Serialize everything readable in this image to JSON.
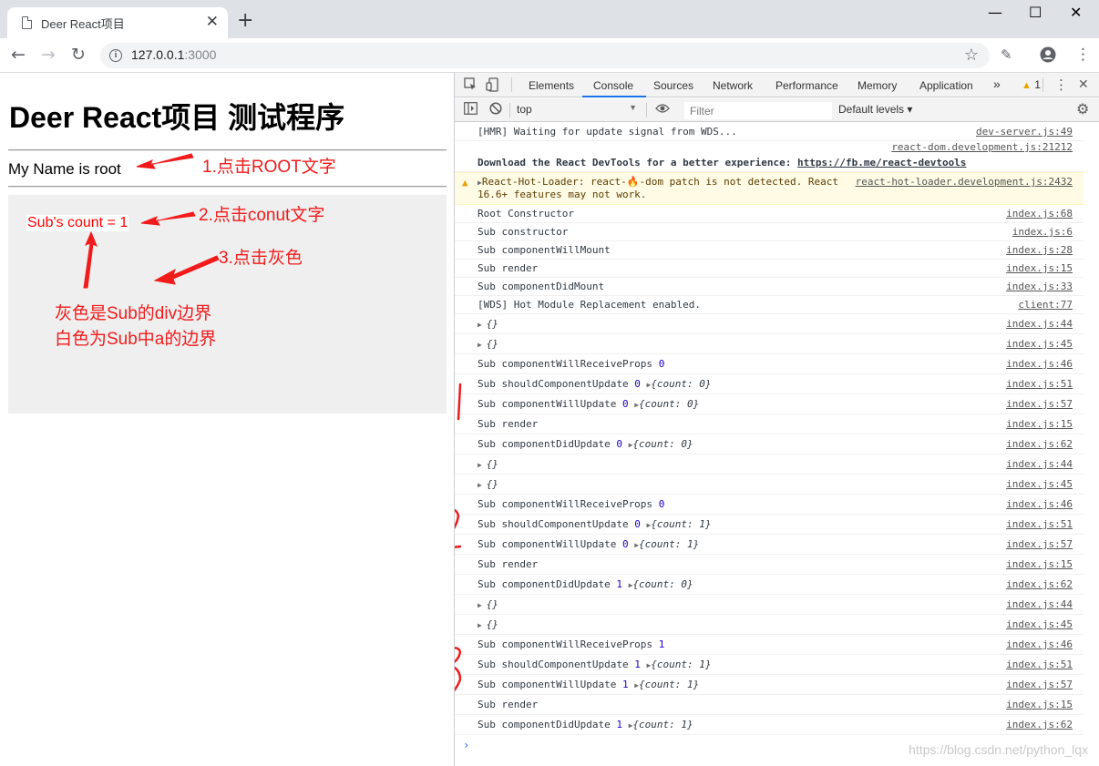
{
  "tab": {
    "title": "Deer React项目",
    "close": "✕",
    "new_tab": "+"
  },
  "window": {
    "minimize": "—",
    "maximize": "☐",
    "close": "✕"
  },
  "toolbar": {
    "back": "←",
    "forward": "→",
    "reload": "↻",
    "url_host": "127.0.0.1",
    "url_port": ":3000",
    "star": "☆",
    "menu": "⋮"
  },
  "page": {
    "heading": "Deer React项目 测试程序",
    "root_text": "My Name is root",
    "sub_link": "Sub's count = 1",
    "annotations": {
      "a1": "1.点击ROOT文字",
      "a2": "2.点击conut文字",
      "a3": "3.点击灰色",
      "note1": "灰色是Sub的div边界",
      "note2": "白色为Sub中a的边界"
    }
  },
  "devtools": {
    "tabs": [
      "Elements",
      "Console",
      "Sources",
      "Network",
      "Performance",
      "Memory",
      "Application"
    ],
    "active_tab": "Console",
    "more": "»",
    "warning_count": "1",
    "context": "top",
    "filter_placeholder": "Filter",
    "levels": "Default levels ▾",
    "rows": [
      {
        "msg": "[HMR] Waiting for update signal from WDS...",
        "src": "dev-server.js:49"
      },
      {
        "msg": "",
        "src": "react-dom.development.js:21212"
      },
      {
        "msg": "Download the React DevTools for a better experience:",
        "link": "https://fb.me/react-devtools",
        "src": ""
      },
      {
        "msg": "React-Hot-Loader: react-🔥-dom patch is not detected. React",
        "msg2": "16.6+ features may not work.",
        "src": "react-hot-loader.development.js:2432"
      },
      {
        "msg": "Root Constructor",
        "src": "index.js:68"
      },
      {
        "msg": "Sub constructor",
        "src": "index.js:6"
      },
      {
        "msg": "Sub componentWillMount",
        "src": "index.js:28"
      },
      {
        "msg": "Sub render",
        "src": "index.js:15"
      },
      {
        "msg": "Sub componentDidMount",
        "src": "index.js:33"
      },
      {
        "msg": "[WDS] Hot Module Replacement enabled.",
        "src": "client:77"
      },
      {
        "msg": "{}",
        "src": "index.js:44"
      },
      {
        "msg": "{}",
        "src": "index.js:45"
      },
      {
        "msg": "Sub componentWillReceiveProps",
        "num": "0",
        "src": "index.js:46"
      },
      {
        "msg": "Sub shouldComponentUpdate",
        "num": "0",
        "obj": "count: 0",
        "src": "index.js:51"
      },
      {
        "msg": "Sub componentWillUpdate",
        "num": "0",
        "obj": "count: 0",
        "src": "index.js:57"
      },
      {
        "msg": "Sub render",
        "src": "index.js:15"
      },
      {
        "msg": "Sub componentDidUpdate",
        "num": "0",
        "obj": "count: 0",
        "src": "index.js:62"
      },
      {
        "msg": "{}",
        "src": "index.js:44"
      },
      {
        "msg": "{}",
        "src": "index.js:45"
      },
      {
        "msg": "Sub componentWillReceiveProps",
        "num": "0",
        "src": "index.js:46"
      },
      {
        "msg": "Sub shouldComponentUpdate",
        "num": "0",
        "obj": "count: 1",
        "src": "index.js:51"
      },
      {
        "msg": "Sub componentWillUpdate",
        "num": "0",
        "obj": "count: 1",
        "src": "index.js:57"
      },
      {
        "msg": "Sub render",
        "src": "index.js:15"
      },
      {
        "msg": "Sub componentDidUpdate",
        "num": "1",
        "obj": "count: 0",
        "src": "index.js:62"
      },
      {
        "msg": "{}",
        "src": "index.js:44"
      },
      {
        "msg": "{}",
        "src": "index.js:45"
      },
      {
        "msg": "Sub componentWillReceiveProps",
        "num": "1",
        "src": "index.js:46"
      },
      {
        "msg": "Sub shouldComponentUpdate",
        "num": "1",
        "obj": "count: 1",
        "src": "index.js:51"
      },
      {
        "msg": "Sub componentWillUpdate",
        "num": "1",
        "obj": "count: 1",
        "src": "index.js:57"
      },
      {
        "msg": "Sub render",
        "src": "index.js:15"
      },
      {
        "msg": "Sub componentDidUpdate",
        "num": "1",
        "obj": "count: 1",
        "src": "index.js:62"
      }
    ],
    "prompt": "›"
  },
  "watermark": "https://blog.csdn.net/python_lqx",
  "colors": {
    "annotation_red": "#f21b1b",
    "link_blue": "#1a73e8",
    "warning_bg": "#fffbe5"
  }
}
